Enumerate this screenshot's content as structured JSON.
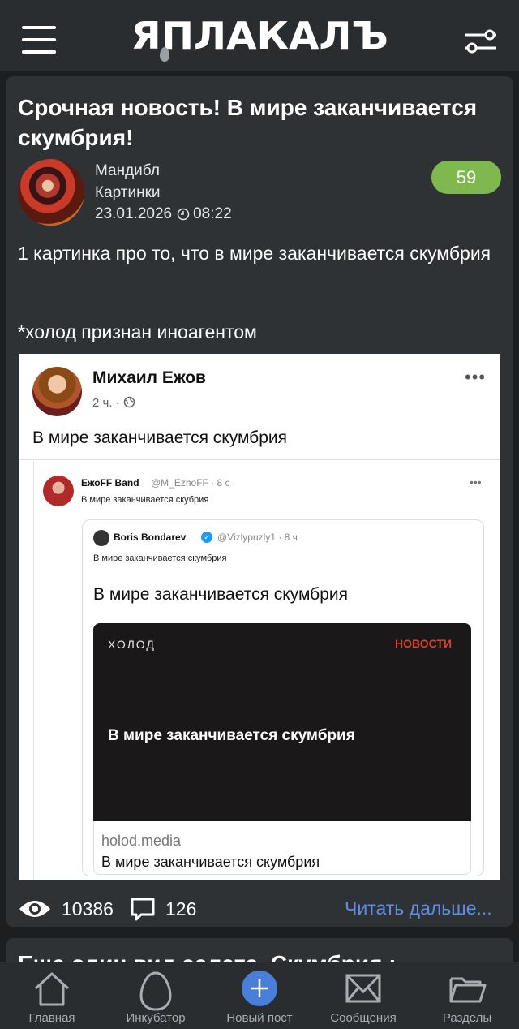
{
  "header": {
    "logo": "ЯПЛАКАЛЪ"
  },
  "post": {
    "title": "Срочная новость! В мире заканчивается скумбрия!",
    "author": "Мандибл",
    "category": "Картинки",
    "date": "23.01.2026",
    "time": "08:22",
    "rating": "59",
    "text1": "1 картинка про то, что в мире заканчивается скумбрия",
    "text2": "*холод признан иноагентом",
    "views": "10386",
    "comments": "126",
    "read_more": "Читать дальше..."
  },
  "image": {
    "fb_name": "Михаил Ежов",
    "fb_time": "2 ч. ·",
    "fb_text": "В мире заканчивается скумбрия",
    "tw1_name": "ЕжоFF Band",
    "tw1_handle": "@M_EzhoFF · 8 с",
    "tw1_text": "В мире заканчивается скубрия",
    "tw2_name": "Boris Bondarev",
    "tw2_handle": "@Vizlypuzly1 · 8 ч",
    "tw2_small": "В мире заканчивается скумбрия",
    "tw2_big": "В мире заканчивается скумбрия",
    "news_brand": "ХОЛОД",
    "news_cat": "НОВОСТИ",
    "news_head": "В мире заканчивается скумбрия",
    "news_domain": "holod.media",
    "news_title": "В мире заканчивается скумбрия"
  },
  "next_post": {
    "title": "Еще один вид салата. Скумбрия :"
  },
  "nav": [
    {
      "label": "Главная",
      "icon": "home-icon"
    },
    {
      "label": "Инкубатор",
      "icon": "egg-icon"
    },
    {
      "label": "Новый пост",
      "icon": "plus-icon"
    },
    {
      "label": "Сообщения",
      "icon": "envelope-icon"
    },
    {
      "label": "Разделы",
      "icon": "folder-icon"
    }
  ],
  "colors": {
    "accent": "#5b8fe6",
    "rating": "#7eb84f",
    "background": "#1c1e20",
    "card": "#2f3235"
  }
}
